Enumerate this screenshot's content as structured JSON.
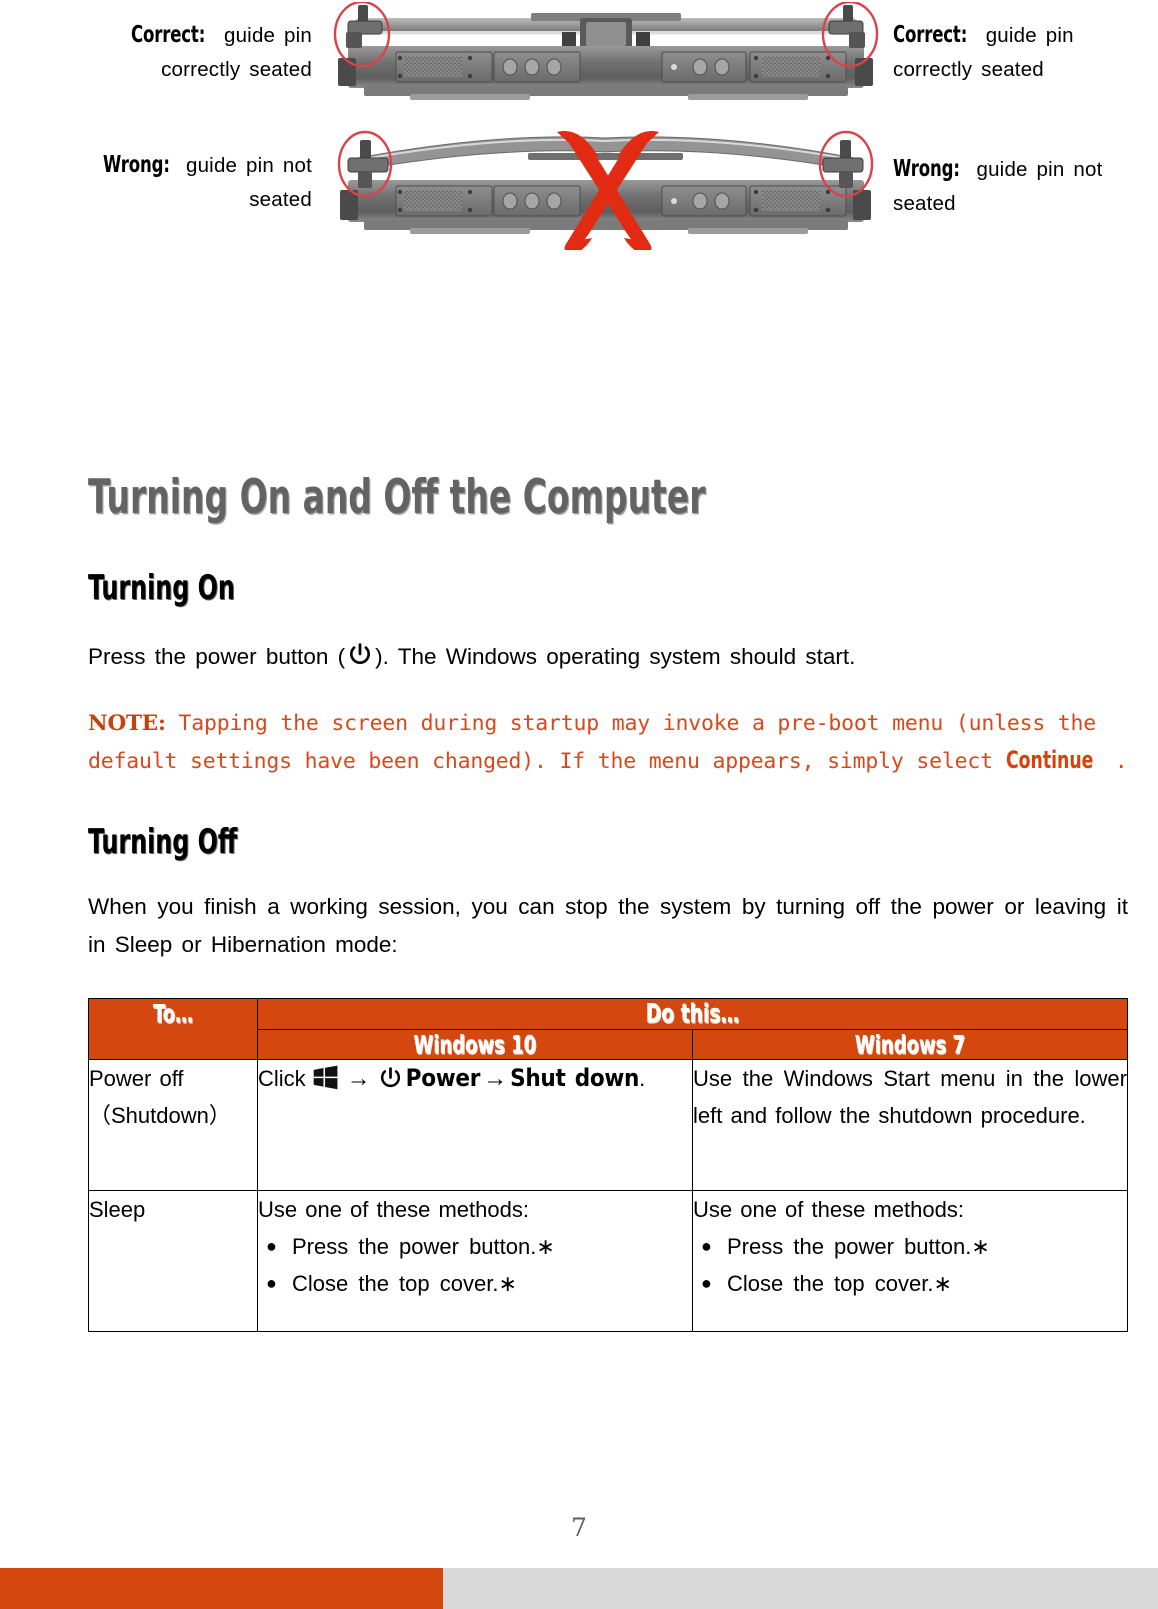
{
  "figure": {
    "callouts": [
      {
        "id": "correct-left",
        "lead": "Correct:",
        "text": "guide pin correctly seated"
      },
      {
        "id": "correct-right",
        "lead": "Correct:",
        "text": "guide pin correctly seated"
      },
      {
        "id": "wrong-left",
        "lead": "Wrong:",
        "text": "guide pin not seated"
      },
      {
        "id": "wrong-right",
        "lead": "Wrong:",
        "text": "guide pin not seated"
      }
    ],
    "images": [
      {
        "name": "rugged-laptop-rear-correct",
        "caption_state": "correct"
      },
      {
        "name": "rugged-laptop-rear-wrong",
        "caption_state": "wrong"
      }
    ]
  },
  "headings": {
    "h1": "Turning On and Off the Computer",
    "turning_on": "Turning On",
    "turning_off": "Turning Off"
  },
  "body": {
    "turning_on_text_before_icon": "Press the power button (",
    "turning_on_text_after_icon": "). The Windows operating system should start.",
    "note_label": "NOTE:",
    "note_text_before_continue": " Tapping the screen during startup may invoke a pre-boot menu (unless the default settings have been changed). If the menu appears, simply select ",
    "note_continue": "Continue",
    "note_text_after_continue": ".",
    "turning_off_text": "When you finish a working session, you can stop the system by turning off the power or leaving it in Sleep or Hibernation mode:"
  },
  "table": {
    "header_to": "To…",
    "header_dothis": "Do this…",
    "header_win10": "Windows 10",
    "header_win7": "Windows 7",
    "rows": [
      {
        "to": "Power off（Shutdown）",
        "to_line1": "Power off",
        "to_line2": "（Shutdown）",
        "win10": {
          "prefix": "Click",
          "icon1": "windows-logo-icon",
          "arrow1": "→",
          "icon2": "power-icon",
          "label_power": "Power",
          "arrow2": "→",
          "label_shutdown": "Shut down",
          "period": "."
        },
        "win7": "Use the Windows Start menu in the lower left and follow the shutdown procedure."
      },
      {
        "to": "Sleep",
        "to_line1": "Sleep",
        "to_line2": "",
        "win10_intro": "Use one of these methods:",
        "win10_bullets": [
          "Press the power button.∗",
          "Close the top cover.∗"
        ],
        "win7_intro": "Use one of these methods:",
        "win7_bullets": [
          "Press the power button.∗",
          "Close the top cover.∗"
        ]
      }
    ]
  },
  "footer": {
    "page_number": "7"
  },
  "colors": {
    "accent_orange": "#D4470F",
    "note_orange": "#D9481C",
    "h1_gray": "#636363",
    "footer_gray": "#D9D9D9",
    "highlight_ellipse_red": "#D9434A"
  }
}
